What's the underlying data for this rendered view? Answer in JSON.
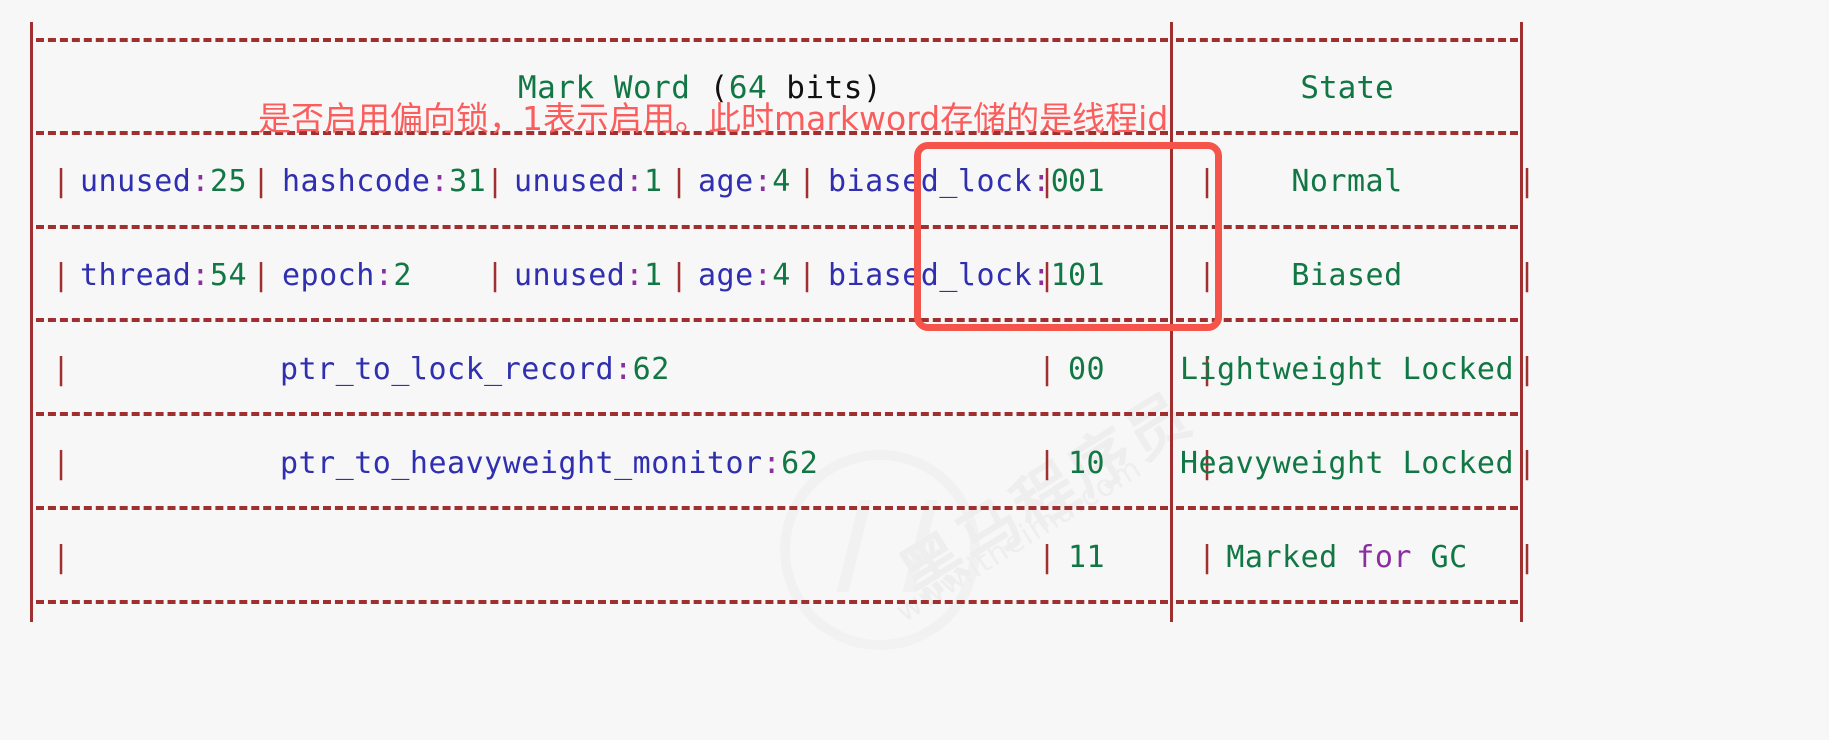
{
  "diagram": {
    "title_parts": {
      "mark": "Mark Word ",
      "paren_open": "(",
      "bits_num": "64",
      "bits_word": " bits",
      "paren_close": ")"
    },
    "state_header": "State",
    "annotation": "是否启用偏向锁，1表示启用。此时markword存储的是线程id",
    "watermark": {
      "brand": "黑马程序员",
      "url": "www.itheima.com"
    },
    "colors": {
      "frame": "#a03030",
      "label": "#2f2fb0",
      "number": "#117744",
      "colon": "#8a2fa0",
      "state": "#117744",
      "annotation": "#fb5d5d",
      "highlight": "#f4544a",
      "background": "#f7f7f7"
    },
    "separator": "|",
    "rows": [
      {
        "id": "normal",
        "fields": [
          {
            "label": "unused",
            "colon": ":",
            "value": "25"
          },
          {
            "label": "hashcode",
            "colon": ":",
            "value": "31"
          },
          {
            "label": "unused",
            "colon": ":",
            "value": "1"
          },
          {
            "label": "age",
            "colon": ":",
            "value": "4"
          },
          {
            "label": "biased_lock",
            "colon": ":",
            "value": "0"
          }
        ],
        "bits": "01",
        "state": "Normal"
      },
      {
        "id": "biased",
        "fields": [
          {
            "label": "thread",
            "colon": ":",
            "value": "54"
          },
          {
            "label": "epoch",
            "colon": ":",
            "value": "2"
          },
          {
            "label": "unused",
            "colon": ":",
            "value": "1"
          },
          {
            "label": "age",
            "colon": ":",
            "value": "4"
          },
          {
            "label": "biased_lock",
            "colon": ":",
            "value": "1"
          }
        ],
        "bits": "01",
        "state": "Biased"
      },
      {
        "id": "lightweight-locked",
        "wide_field": {
          "label": "ptr_to_lock_record",
          "colon": ":",
          "value": "62"
        },
        "bits": "00",
        "state": "Lightweight Locked"
      },
      {
        "id": "heavyweight-locked",
        "wide_field": {
          "label": "ptr_to_heavyweight_monitor",
          "colon": ":",
          "value": "62"
        },
        "bits": "10",
        "state": "Heavyweight Locked"
      },
      {
        "id": "marked-for-gc",
        "wide_field": {
          "label": "",
          "colon": "",
          "value": ""
        },
        "bits": "11",
        "state_parts": {
          "pre": "Marked ",
          "mid": "for",
          "post": " GC"
        },
        "state": "Marked for GC"
      }
    ]
  }
}
